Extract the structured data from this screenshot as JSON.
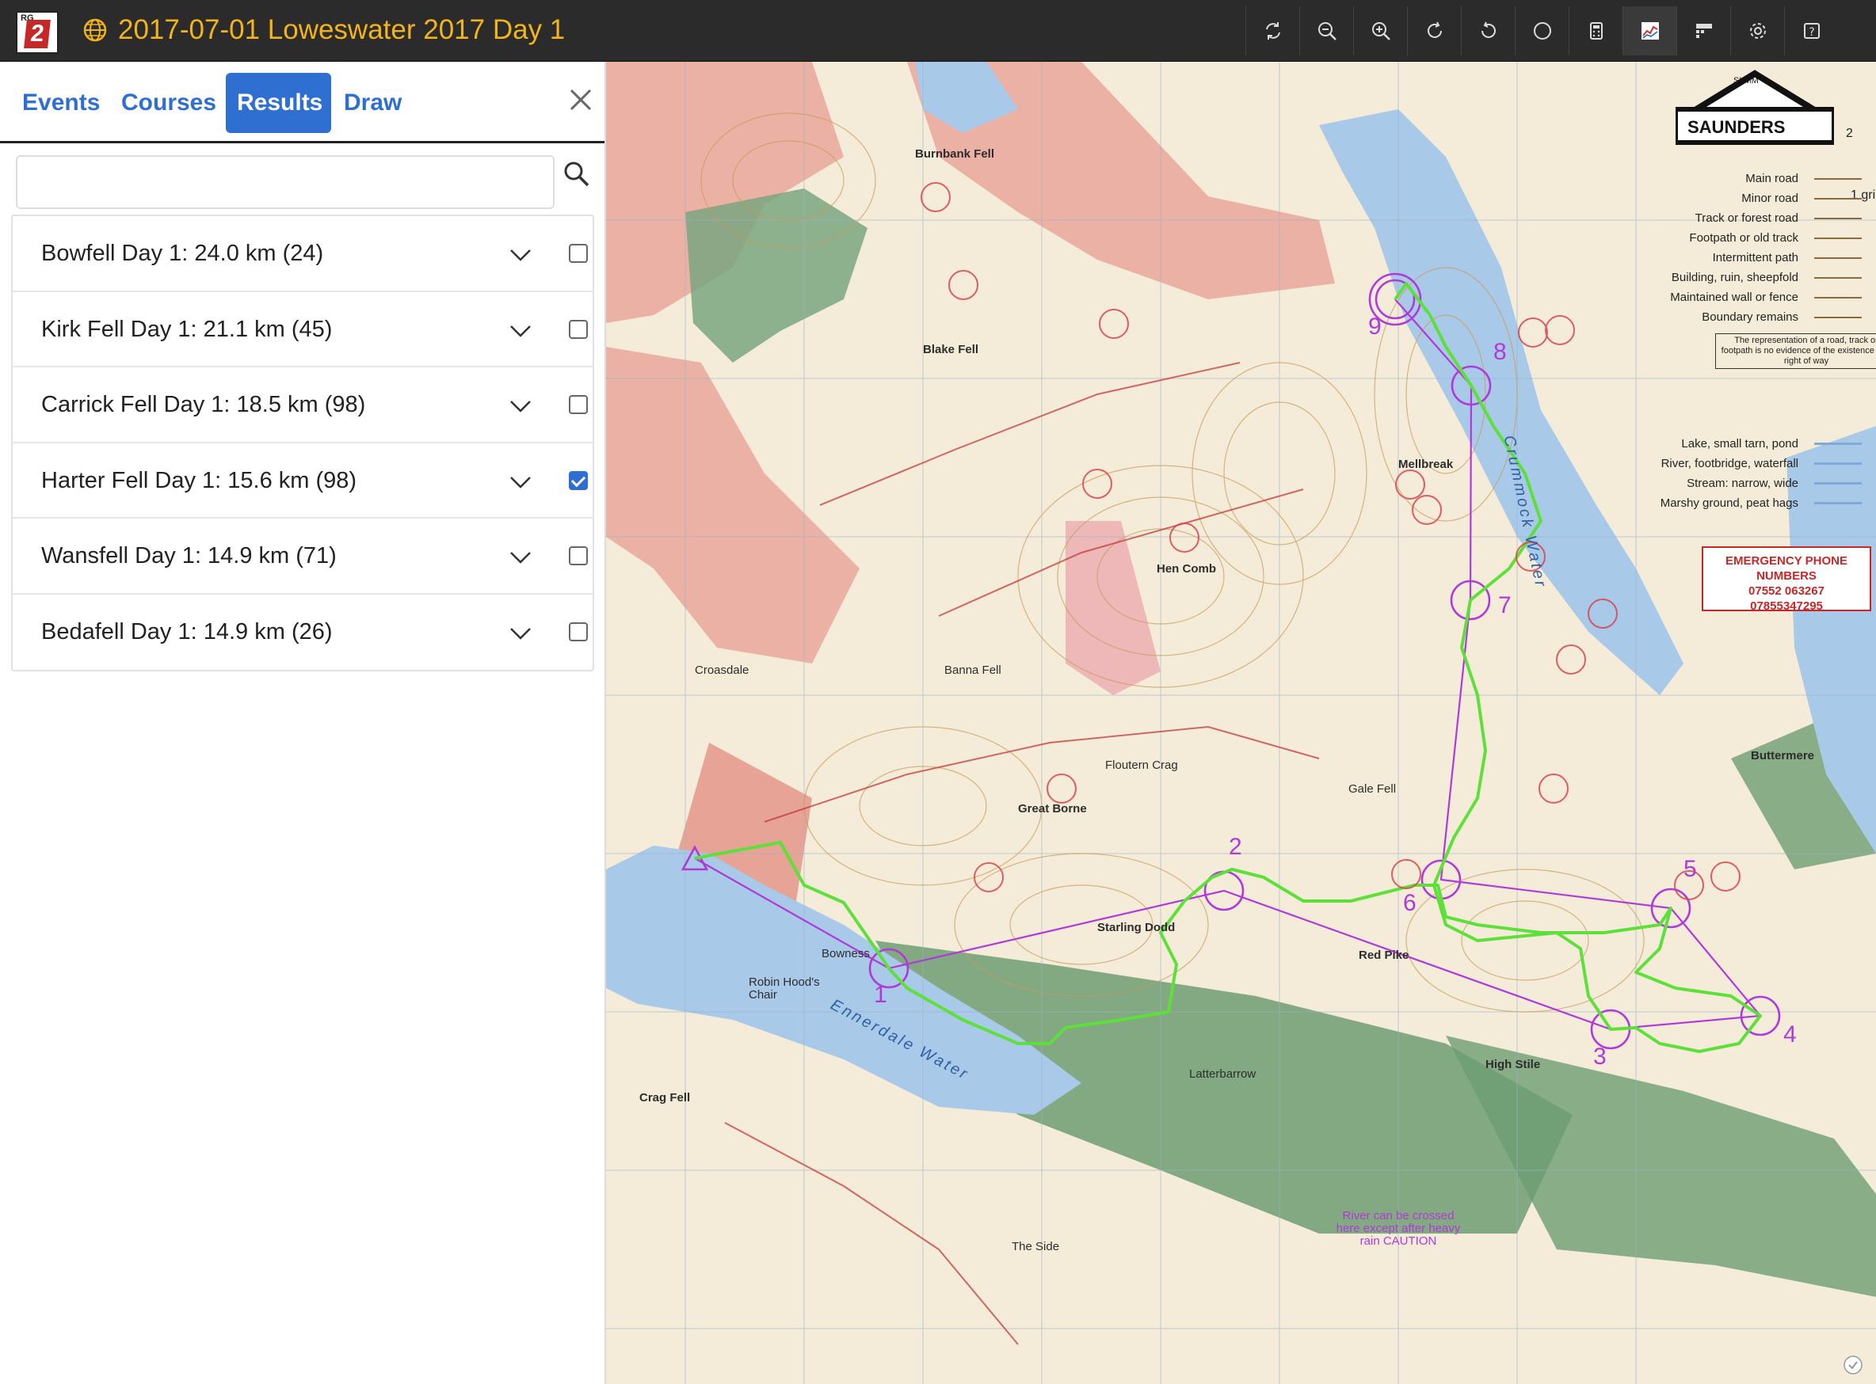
{
  "app": {
    "logo_text": "RG",
    "logo_number": "2",
    "title": "2017-07-01 Loweswater 2017 Day 1"
  },
  "toolbar": {
    "icons": [
      "refresh-icon",
      "zoom-out-icon",
      "zoom-in-icon",
      "rotate-right-icon",
      "rotate-left-icon",
      "circle-icon",
      "calculator-icon",
      "graph-icon",
      "split-times-icon",
      "settings-icon",
      "help-icon"
    ]
  },
  "tabs": [
    {
      "label": "Events"
    },
    {
      "label": "Courses"
    },
    {
      "label": "Results",
      "active": true
    },
    {
      "label": "Draw"
    }
  ],
  "search": {
    "value": "",
    "placeholder": ""
  },
  "courses": [
    {
      "label": "Bowfell Day 1: 24.0 km (24)",
      "checked": false
    },
    {
      "label": "Kirk Fell Day 1: 21.1 km (45)",
      "checked": false
    },
    {
      "label": "Carrick Fell Day 1: 18.5 km (98)",
      "checked": false
    },
    {
      "label": "Harter Fell Day 1: 15.6 km (98)",
      "checked": true
    },
    {
      "label": "Wansfell Day 1: 14.9 km (71)",
      "checked": false
    },
    {
      "label": "Bedafell Day 1: 14.9 km (26)",
      "checked": false
    }
  ],
  "map": {
    "brand": "SAUNDERS",
    "brand_small": "SLMM",
    "legend": [
      "Main road",
      "Minor road",
      "Track or forest road",
      "Footpath or old track",
      "Intermittent path",
      "Building, ruin, sheepfold",
      "Maintained wall or fence",
      "Boundary remains"
    ],
    "legend_note": "The representation of a road, track or footpath is no evidence of the existence of a right of way",
    "legend2": [
      "Lake, small tarn, pond",
      "River, footbridge, waterfall",
      "Stream: narrow, wide",
      "Marshy ground, peat hags"
    ],
    "emergency": {
      "title": "EMERGENCY PHONE NUMBERS",
      "phone1": "07552 063267",
      "phone2": "07855347295"
    },
    "place_names": {
      "burnbank": "Burnbank Fell",
      "blake": "Blake Fell",
      "mellbreak": "Mellbreak",
      "hencomb": "Hen Comb",
      "starling": "Starling Dodd",
      "redpike": "Red Pike",
      "highstile": "High Stile",
      "greatborne": "Great Borne",
      "crossdale": "Croasdale",
      "lattebarrow": "Latterbarrow",
      "crummock": "Crummock Water",
      "ennerdale": "Ennerdale Water",
      "cragfell": "Crag Fell",
      "theside": "The Side",
      "bowness": "Bowness",
      "robinhood": "Robin Hood's Chair",
      "gale": "Gale Fell",
      "buttermere": "Buttermere",
      "floutern": "Floutern Crag",
      "bannafell": "Banna Fell",
      "caution": "River can be crossed here except after heavy rain CAUTION"
    },
    "controls": [
      "1",
      "2",
      "3",
      "4",
      "5",
      "6",
      "7",
      "8",
      "9"
    ],
    "scale_text": "1 gri",
    "page_num": "2"
  },
  "colors": {
    "accent": "#2f6fd1",
    "title": "#f2b31b",
    "topbar": "#2b2b2b",
    "course": "#b03ad8",
    "route": "#5ee03a"
  }
}
